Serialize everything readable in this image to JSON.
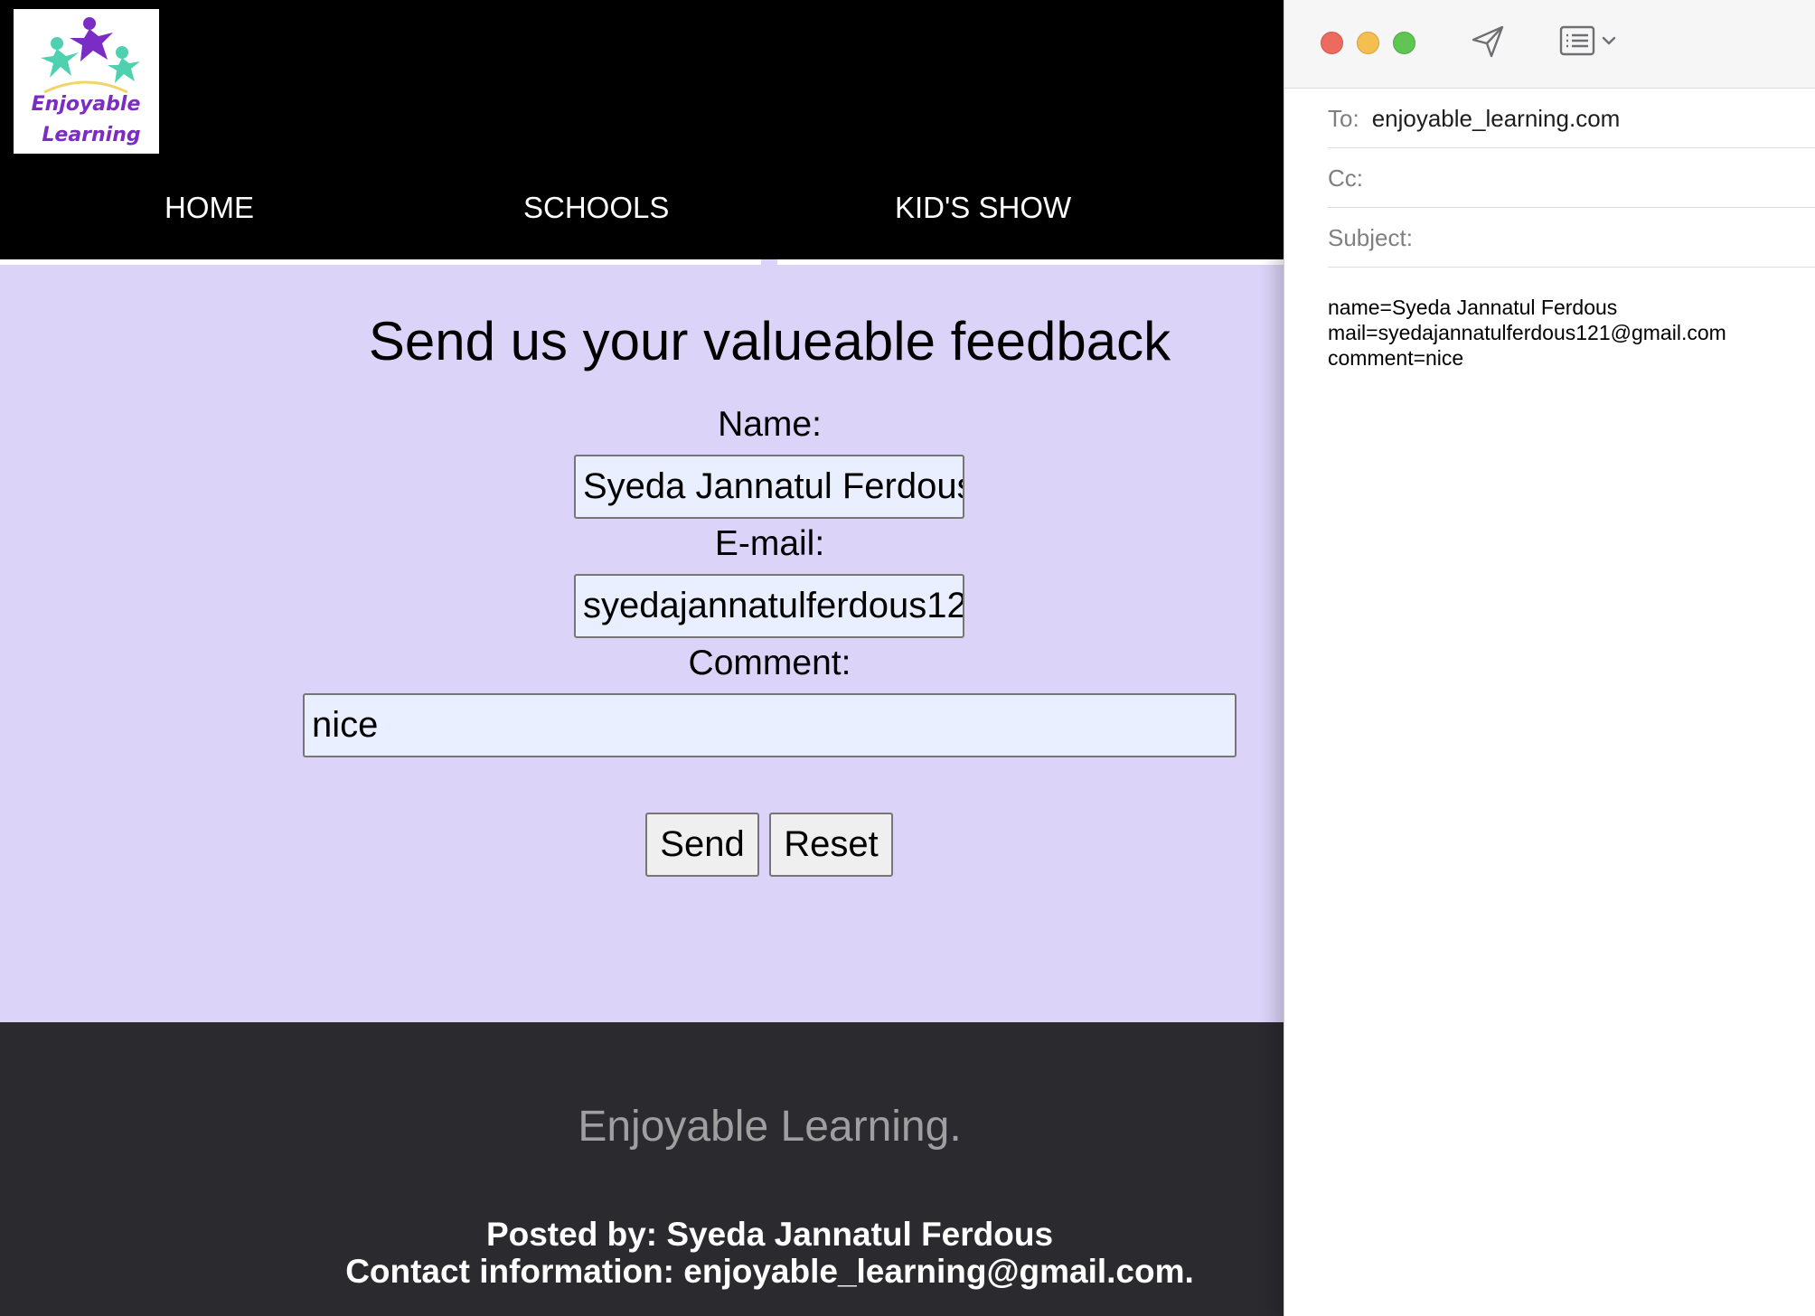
{
  "site": {
    "logo": {
      "line1": "Enjoyable",
      "line2": "Learning"
    },
    "nav": [
      {
        "label": "HOME"
      },
      {
        "label": "SCHOOLS"
      },
      {
        "label": "KID'S SHOW"
      }
    ],
    "form": {
      "heading": "Send us your valueable feedback",
      "name_label": "Name:",
      "name_value": "Syeda Jannatul Ferdous",
      "email_label": "E-mail:",
      "email_value": "syedajannatulferdous121@gmail.com",
      "comment_label": "Comment:",
      "comment_value": "nice",
      "send_label": "Send",
      "reset_label": "Reset"
    },
    "footer": {
      "brand": "Enjoyable Learning.",
      "posted_by": "Posted by: Syeda Jannatul Ferdous",
      "contact": "Contact information: enjoyable_learning@gmail.com."
    },
    "colors": {
      "content_bg": "#dcd4f8",
      "header_bg": "#000000",
      "footer_bg": "#2b2a2f",
      "logo_purple": "#7b2cc4",
      "logo_teal": "#4fd1b0"
    }
  },
  "mail": {
    "toolbar": {
      "icons": [
        "close-light",
        "minimize-light",
        "zoom-light",
        "send-paper-plane-icon",
        "header-fields-icon",
        "chevron-down-icon"
      ]
    },
    "to_label": "To:",
    "to_value": "enjoyable_learning.com",
    "cc_label": "Cc:",
    "subject_label": "Subject:",
    "body_lines": [
      "name=Syeda Jannatul Ferdous",
      "mail=syedajannatulferdous121@gmail.com",
      "comment=nice"
    ]
  }
}
